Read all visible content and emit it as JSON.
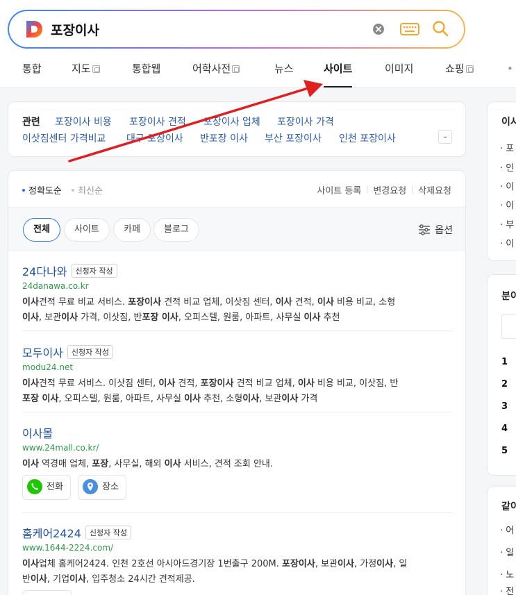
{
  "search": {
    "query": "포장이사"
  },
  "tabs": [
    {
      "label": "통합",
      "external": false
    },
    {
      "label": "지도",
      "external": true
    },
    {
      "label": "통합웹",
      "external": false
    },
    {
      "label": "어학사전",
      "external": true
    },
    {
      "label": "뉴스",
      "external": false
    },
    {
      "label": "사이트",
      "external": false,
      "active": true
    },
    {
      "label": "이미지",
      "external": false
    },
    {
      "label": "쇼핑",
      "external": true
    }
  ],
  "related": {
    "title": "관련",
    "links": [
      "포장이사 비용",
      "포장이사 견적",
      "포장이사 업체",
      "포장이사 가격",
      "이삿짐센터 가격비교",
      "대구 포장이사",
      "반포장 이사",
      "부산 포장이사",
      "인천 포장이사"
    ]
  },
  "sort": {
    "accuracy": "정확도순",
    "latest": "최신순"
  },
  "site_actions": [
    "사이트 등록",
    "변경요청",
    "삭제요청"
  ],
  "filters": [
    "전체",
    "사이트",
    "카페",
    "블로그"
  ],
  "option_label": "옵션",
  "results": [
    {
      "title": "24다나와",
      "badge": "신청자 작성",
      "url": "24danawa.co.kr",
      "desc1": [
        [
          "이사",
          1
        ],
        [
          "견적 무료 비교 서비스. ",
          0
        ],
        [
          "포장이사",
          1
        ],
        [
          " 견적 비교 업체, 이삿짐 센터, ",
          0
        ],
        [
          "이사",
          1
        ],
        [
          " 견적, ",
          0
        ],
        [
          "이사",
          1
        ],
        [
          " 비용 비교, 소형",
          0
        ]
      ],
      "desc2": [
        [
          "이사",
          1
        ],
        [
          ", 보관",
          0
        ],
        [
          "이사",
          1
        ],
        [
          " 가격, 이삿짐, 반",
          0
        ],
        [
          "포장 이사",
          1
        ],
        [
          ", 오피스텔, 원룸, 아파트, 사무실 ",
          0
        ],
        [
          "이사",
          1
        ],
        [
          " 추천",
          0
        ]
      ]
    },
    {
      "title": "모두이사",
      "badge": "신청자 작성",
      "url": "modu24.net",
      "desc1": [
        [
          "이사",
          1
        ],
        [
          "견적 무료 서비스. 이삿짐 센터, ",
          0
        ],
        [
          "이사",
          1
        ],
        [
          " 견적, ",
          0
        ],
        [
          "포장이사",
          1
        ],
        [
          " 견적 비교 업체, ",
          0
        ],
        [
          "이사",
          1
        ],
        [
          " 비용 비교, 이삿짐, 반",
          0
        ]
      ],
      "desc2": [
        [
          "포장 이사",
          1
        ],
        [
          ", 오피스텔, 원룸, 아파트, 사무실 ",
          0
        ],
        [
          "이사",
          1
        ],
        [
          " 추천, 소형",
          0
        ],
        [
          "이사",
          1
        ],
        [
          ", 보관",
          0
        ],
        [
          "이사",
          1
        ],
        [
          " 가격",
          0
        ]
      ]
    },
    {
      "title": "이사몰",
      "badge": "",
      "url": "www.24mall.co.kr/",
      "desc1": [
        [
          "이사",
          1
        ],
        [
          " 역경매 업체, ",
          0
        ],
        [
          "포장",
          1
        ],
        [
          ", 사무실, 해외 ",
          0
        ],
        [
          "이사",
          1
        ],
        [
          " 서비스, 견적 조회 안내.",
          0
        ]
      ],
      "desc2": [],
      "buttons": [
        {
          "label": "전화",
          "icon": "phone-icon",
          "color": "#1ec800"
        },
        {
          "label": "장소",
          "icon": "map-pin-icon",
          "color": "#4a90e2"
        }
      ]
    },
    {
      "title": "홈케어2424",
      "badge": "신청자 작성",
      "url": "www.1644-2224.com/",
      "desc1": [
        [
          "이사",
          1
        ],
        [
          "업체 홈케어2424. 인천 2호선 아시아드경기장 1번출구 200M. ",
          0
        ],
        [
          "포장이사",
          1
        ],
        [
          ", 보관",
          0
        ],
        [
          "이사",
          1
        ],
        [
          ", 가정",
          0
        ],
        [
          "이사",
          1
        ],
        [
          ", 일",
          0
        ]
      ],
      "desc2": [
        [
          "반",
          0
        ],
        [
          "이사",
          1
        ],
        [
          ", 기업",
          0
        ],
        [
          "이사",
          1
        ],
        [
          ", 입주청소 24시간 견적제공.",
          0
        ]
      ]
    }
  ],
  "rail": {
    "card1": {
      "title": "이시",
      "bullets": [
        "포",
        "인",
        "이",
        "이",
        "부",
        "이"
      ]
    },
    "card2": {
      "title": "분이",
      "nums": [
        "1",
        "2",
        "3",
        "4",
        "5"
      ]
    },
    "card3": {
      "title": "같이",
      "bullets": [
        "어",
        "일",
        "노",
        "전"
      ]
    }
  }
}
